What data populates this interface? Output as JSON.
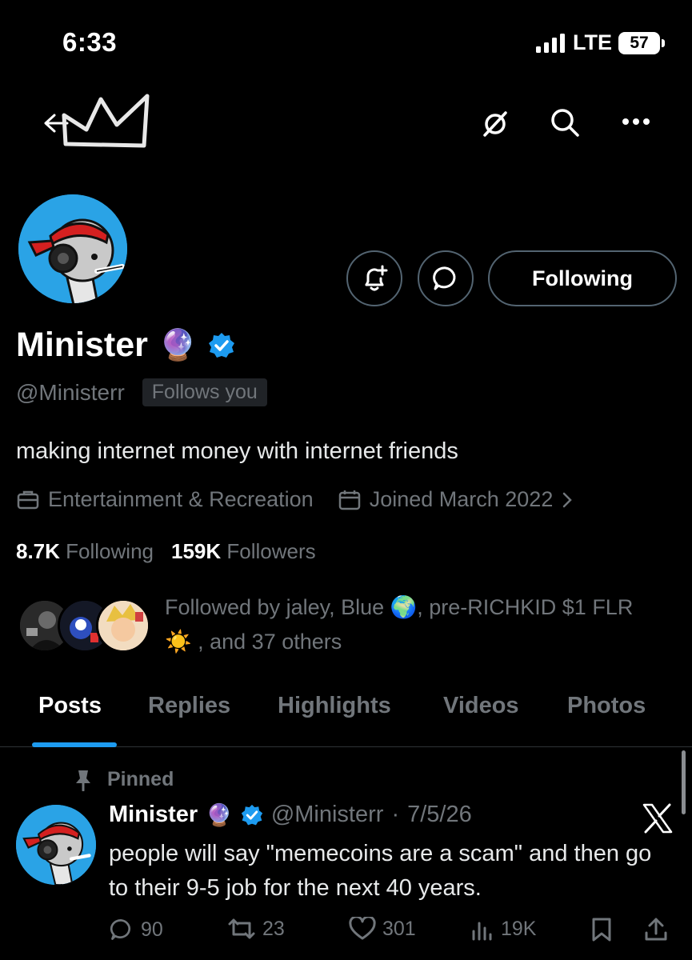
{
  "status_bar": {
    "time": "6:33",
    "network": "LTE",
    "battery": "57"
  },
  "header": {
    "back_icon": "back-arrow-icon",
    "banner_icon": "crown-icon",
    "actions": [
      "grok-icon",
      "search-icon",
      "more-icon"
    ]
  },
  "profile": {
    "name": "Minister",
    "name_emoji": "🔮",
    "verified_icon": "verified-badge-icon",
    "handle": "@Ministerr",
    "follows_you": "Follows you",
    "bio": "making internet money with internet friends",
    "category": "Entertainment & Recreation",
    "joined": "Joined March 2022",
    "following_count": "8.7K",
    "following_label": "Following",
    "followers_count": "159K",
    "followers_label": "Followers",
    "follow_button": "Following",
    "followed_by_line1": "Followed by jaley, Blue 🌍, pre-RICHKID $1 FLR",
    "followed_by_line2": "☀️ , and 37 others"
  },
  "tabs": [
    "Posts",
    "Replies",
    "Highlights",
    "Videos",
    "Photos"
  ],
  "active_tab": "Posts",
  "pinned_post": {
    "pinned_label": "Pinned",
    "author": "Minister",
    "author_emoji": "🔮",
    "handle": "@Ministerr",
    "date": "7/5/26",
    "text": "people will say \"memecoins are a scam\" and then go to their 9-5 job for the next 40 years.",
    "replies": "90",
    "reposts": "23",
    "likes": "301",
    "views": "19K"
  },
  "colors": {
    "accent": "#1d9bf0",
    "background": "#000000",
    "muted": "#71767b"
  }
}
